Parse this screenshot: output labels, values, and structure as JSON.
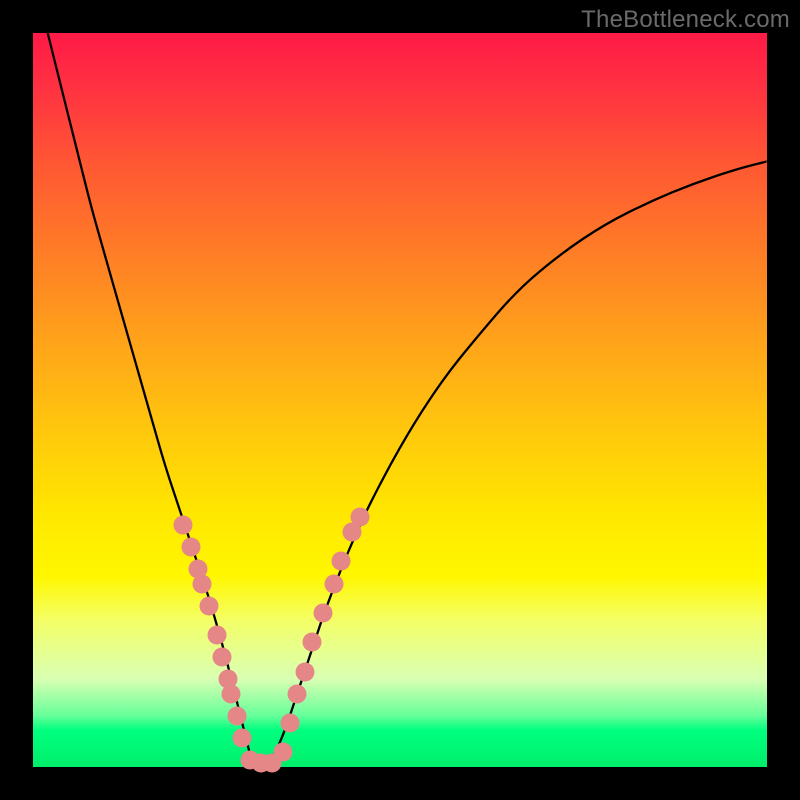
{
  "watermark": "TheBottleneck.com",
  "colors": {
    "dot": "#e58787",
    "curve": "#000000",
    "frame": "#000000"
  },
  "chart_data": {
    "type": "line",
    "title": "",
    "xlabel": "",
    "ylabel": "",
    "xlim": [
      0,
      100
    ],
    "ylim": [
      0,
      100
    ],
    "grid": false,
    "series": [
      {
        "name": "bottleneck-curve",
        "x": [
          2,
          4,
          6,
          8,
          10,
          12,
          14,
          16,
          18,
          20,
          22,
          24,
          26,
          27,
          28,
          29,
          30,
          32,
          34,
          36,
          38,
          40,
          44,
          48,
          52,
          56,
          60,
          66,
          72,
          78,
          84,
          90,
          96,
          100
        ],
        "y": [
          100,
          92,
          84,
          76,
          69,
          62,
          55,
          48,
          41,
          35,
          29,
          23,
          16,
          12,
          8,
          4,
          0,
          0,
          4,
          10,
          16,
          22,
          32,
          40,
          47,
          53,
          58,
          65,
          70,
          74,
          77,
          79.5,
          81.5,
          82.5
        ]
      }
    ],
    "points": [
      {
        "name": "left-dot-1",
        "x": 20.5,
        "y": 33
      },
      {
        "name": "left-dot-2",
        "x": 21.5,
        "y": 30
      },
      {
        "name": "left-dot-3",
        "x": 22.5,
        "y": 27
      },
      {
        "name": "left-dot-4",
        "x": 23.0,
        "y": 25
      },
      {
        "name": "left-dot-5",
        "x": 24.0,
        "y": 22
      },
      {
        "name": "left-dot-6",
        "x": 25.0,
        "y": 18
      },
      {
        "name": "left-dot-7",
        "x": 25.8,
        "y": 15
      },
      {
        "name": "left-dot-8",
        "x": 26.5,
        "y": 12
      },
      {
        "name": "left-dot-9",
        "x": 27.0,
        "y": 10
      },
      {
        "name": "left-dot-10",
        "x": 27.8,
        "y": 7
      },
      {
        "name": "left-dot-11",
        "x": 28.5,
        "y": 4
      },
      {
        "name": "bottom-dot-1",
        "x": 29.5,
        "y": 1
      },
      {
        "name": "bottom-dot-2",
        "x": 31.0,
        "y": 0.5
      },
      {
        "name": "bottom-dot-3",
        "x": 32.5,
        "y": 0.5
      },
      {
        "name": "bottom-dot-4",
        "x": 34.0,
        "y": 2
      },
      {
        "name": "right-dot-1",
        "x": 35.0,
        "y": 6
      },
      {
        "name": "right-dot-2",
        "x": 36.0,
        "y": 10
      },
      {
        "name": "right-dot-3",
        "x": 37.0,
        "y": 13
      },
      {
        "name": "right-dot-4",
        "x": 38.0,
        "y": 17
      },
      {
        "name": "right-dot-5",
        "x": 39.5,
        "y": 21
      },
      {
        "name": "right-dot-6",
        "x": 41.0,
        "y": 25
      },
      {
        "name": "right-dot-7",
        "x": 42.0,
        "y": 28
      },
      {
        "name": "right-dot-8",
        "x": 43.5,
        "y": 32
      },
      {
        "name": "right-dot-9",
        "x": 44.5,
        "y": 34
      }
    ]
  }
}
